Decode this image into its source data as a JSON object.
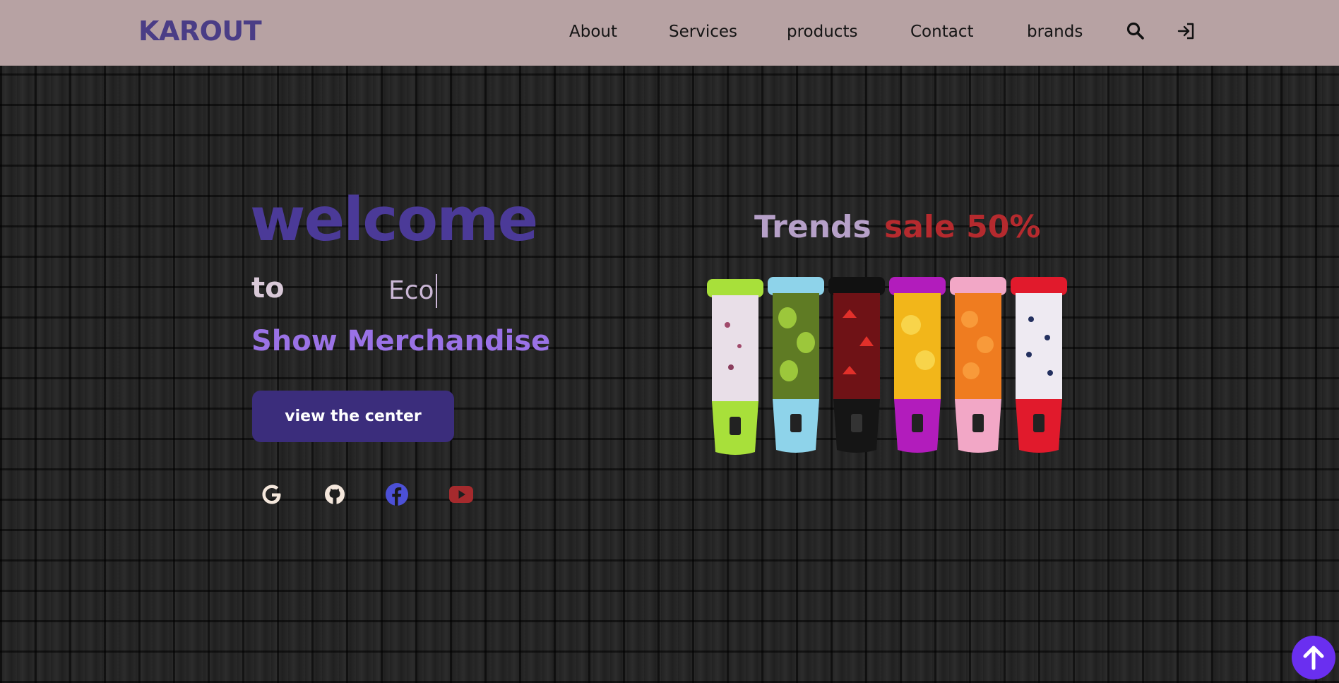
{
  "navbar": {
    "logo": "KAROUT",
    "links": [
      "About",
      "Services",
      "products",
      "Contact",
      "brands"
    ],
    "search_icon": "search-icon",
    "login_icon": "sign-in-icon"
  },
  "hero": {
    "welcome": "welcome",
    "to": "to",
    "typed_text": "Eco",
    "subtitle": "Show Merchandise",
    "cta_label": "view the center",
    "social_icons": [
      "google-icon",
      "github-icon",
      "facebook-icon",
      "youtube-icon"
    ]
  },
  "promo": {
    "trends": "Trends",
    "sale": "sale 50%"
  },
  "colors": {
    "navbar_bg": "#b7a2a3",
    "logo": "#4a3d86",
    "welcome": "#4b3a98",
    "subtitle": "#9a72e6",
    "cta_bg": "#3b2d7c",
    "sale": "#b52a2e",
    "trends": "#b6a0c8",
    "scroll_top": "#6a2ff0"
  }
}
